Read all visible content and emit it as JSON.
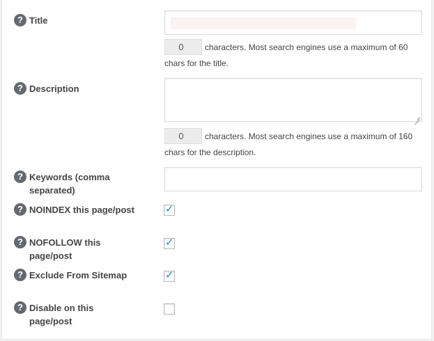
{
  "fields": {
    "title": {
      "label": "Title",
      "value": "",
      "counter": "0",
      "counter_text": "characters. Most search engines use a maximum of 60 chars for the title."
    },
    "description": {
      "label": "Description",
      "value": "",
      "counter": "0",
      "counter_text": "characters. Most search engines use a maximum of 160 chars for the description."
    },
    "keywords": {
      "label": "Keywords (comma separated)",
      "value": ""
    },
    "noindex": {
      "label": "NOINDEX this page/post",
      "checked": true
    },
    "nofollow": {
      "label": "NOFOLLOW this page/post",
      "checked": true
    },
    "exclude_sitemap": {
      "label": "Exclude From Sitemap",
      "checked": true
    },
    "disable": {
      "label": "Disable on this page/post",
      "checked": false
    }
  },
  "help_glyph": "?",
  "checkmark_glyph": "✓",
  "colors": {
    "help_icon_bg": "#646970",
    "checkmark": "#1e8cbe",
    "counter_bg": "#ececec",
    "border": "#dddddd"
  }
}
